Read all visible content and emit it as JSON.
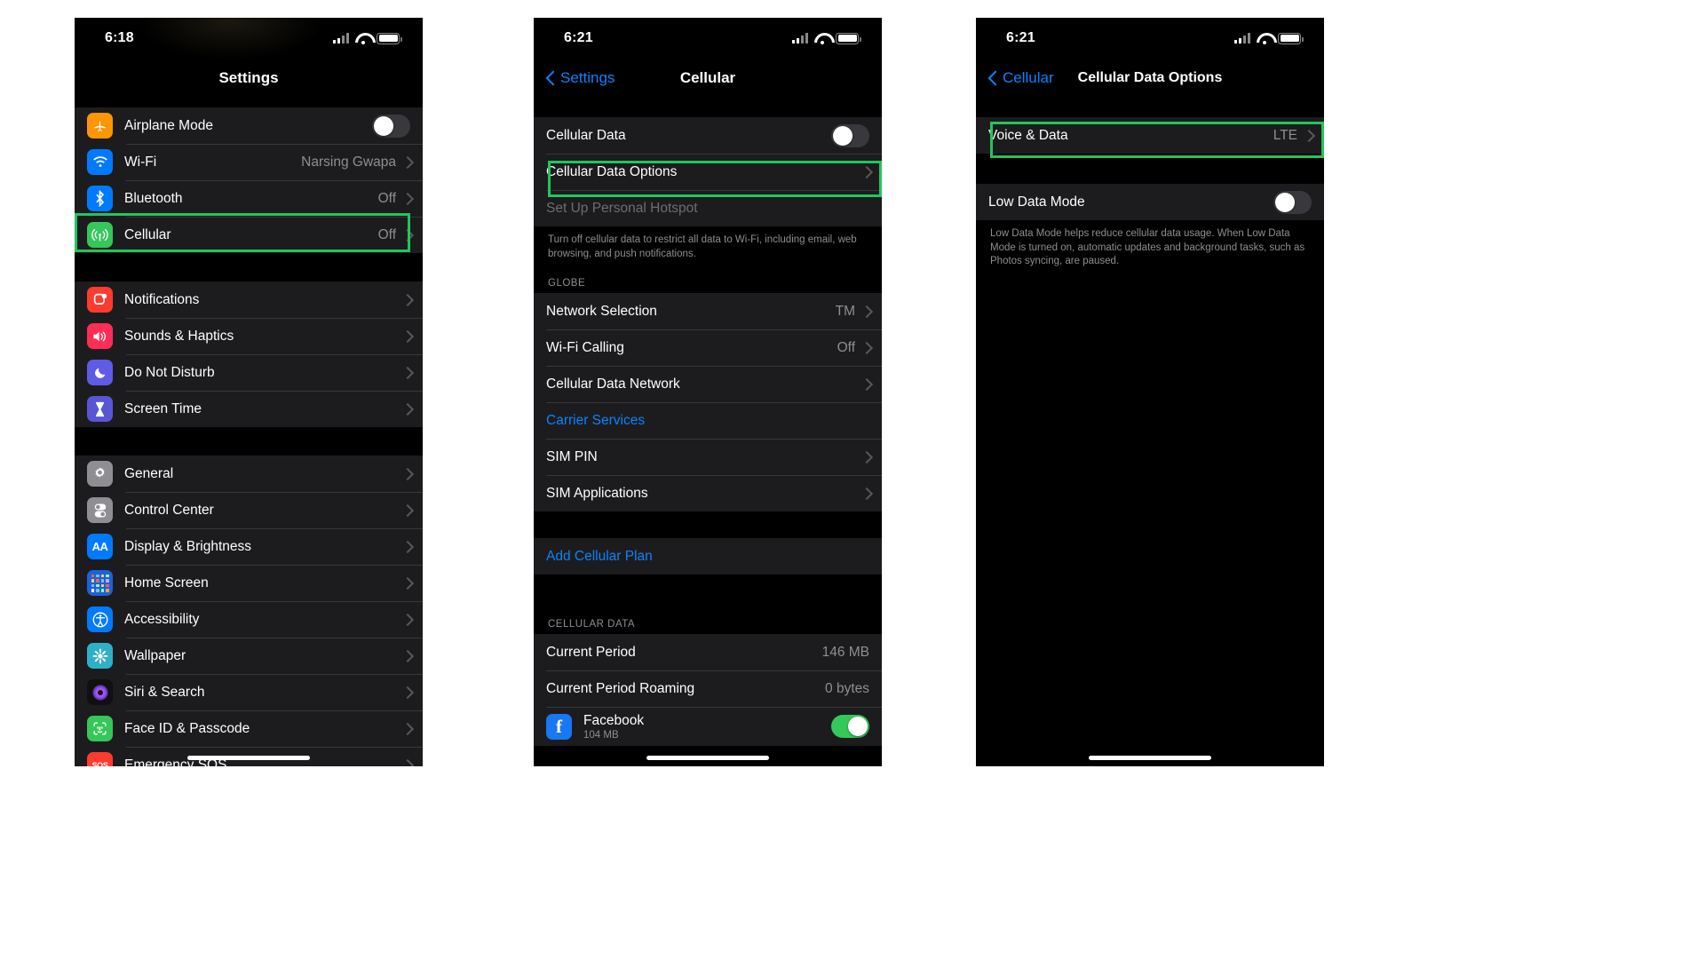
{
  "screens": [
    {
      "id": "settings-root",
      "status": {
        "time": "6:18",
        "signal_icon": "cellular-bars-icon",
        "wifi_icon": "wifi-icon",
        "battery_icon": "battery-icon"
      },
      "nav": {
        "title": "Settings",
        "back_label": null
      },
      "sections": [
        {
          "rows": [
            {
              "icon": "airplane-icon",
              "icon_class": "ic-airplane",
              "glyph": "✈",
              "label": "Airplane Mode",
              "control": "switch",
              "switch_on": false
            },
            {
              "icon": "wifi-icon",
              "icon_class": "ic-wifi",
              "glyph": "wifi",
              "label": "Wi-Fi",
              "value": "Narsing Gwapa",
              "control": "chevron"
            },
            {
              "icon": "bluetooth-icon",
              "icon_class": "ic-bluetooth",
              "glyph": "ᛗ",
              "label": "Bluetooth",
              "value": "Off",
              "control": "chevron"
            },
            {
              "icon": "cellular-icon",
              "icon_class": "ic-cellular",
              "glyph": "cellular",
              "label": "Cellular",
              "value": "Off",
              "control": "chevron",
              "highlight": true
            }
          ]
        },
        {
          "rows": [
            {
              "icon": "notifications-icon",
              "icon_class": "ic-notifications",
              "glyph": "notif",
              "label": "Notifications",
              "control": "chevron"
            },
            {
              "icon": "sounds-icon",
              "icon_class": "ic-sounds",
              "glyph": "🔊",
              "label": "Sounds & Haptics",
              "control": "chevron"
            },
            {
              "icon": "do-not-disturb-icon",
              "icon_class": "ic-dnd",
              "glyph": "☽",
              "label": "Do Not Disturb",
              "control": "chevron"
            },
            {
              "icon": "screen-time-icon",
              "icon_class": "ic-screentime",
              "glyph": "⌛",
              "label": "Screen Time",
              "control": "chevron"
            }
          ]
        },
        {
          "rows": [
            {
              "icon": "general-gear-icon",
              "icon_class": "ic-general",
              "glyph": "⚙",
              "label": "General",
              "control": "chevron"
            },
            {
              "icon": "control-center-icon",
              "icon_class": "ic-controlcenter",
              "glyph": "toggles",
              "label": "Control Center",
              "control": "chevron"
            },
            {
              "icon": "display-brightness-icon",
              "icon_class": "ic-display",
              "glyph": "AA",
              "label": "Display & Brightness",
              "control": "chevron"
            },
            {
              "icon": "home-screen-icon",
              "icon_class": "ic-homescreen",
              "glyph": "grid",
              "label": "Home Screen",
              "control": "chevron"
            },
            {
              "icon": "accessibility-icon",
              "icon_class": "ic-accessibility",
              "glyph": "accessibility",
              "label": "Accessibility",
              "control": "chevron"
            },
            {
              "icon": "wallpaper-icon",
              "icon_class": "ic-wallpaper",
              "glyph": "✿",
              "label": "Wallpaper",
              "control": "chevron"
            },
            {
              "icon": "siri-search-icon",
              "icon_class": "ic-siri",
              "glyph": "siri",
              "label": "Siri & Search",
              "control": "chevron"
            },
            {
              "icon": "face-id-icon",
              "icon_class": "ic-faceid",
              "glyph": "face",
              "label": "Face ID & Passcode",
              "control": "chevron"
            },
            {
              "icon": "emergency-sos-icon",
              "icon_class": "ic-emergency",
              "glyph": "SOS",
              "label": "Emergency SOS",
              "control": "chevron"
            }
          ]
        }
      ]
    },
    {
      "id": "cellular",
      "status": {
        "time": "6:21"
      },
      "nav": {
        "title": "Cellular",
        "back_label": "Settings"
      },
      "sections": [
        {
          "rows": [
            {
              "label": "Cellular Data",
              "control": "switch",
              "switch_on": false
            },
            {
              "label": "Cellular Data Options",
              "control": "chevron",
              "highlight": true
            },
            {
              "label": "Set Up Personal Hotspot",
              "control": "none",
              "dim": true
            }
          ],
          "footnote": "Turn off cellular data to restrict all data to Wi-Fi, including email, web browsing, and push notifications."
        },
        {
          "header": "GLOBE",
          "rows": [
            {
              "label": "Network Selection",
              "value": "TM",
              "control": "chevron"
            },
            {
              "label": "Wi-Fi Calling",
              "value": "Off",
              "control": "chevron"
            },
            {
              "label": "Cellular Data Network",
              "control": "chevron"
            },
            {
              "label": "Carrier Services",
              "control": "none",
              "blue": true
            },
            {
              "label": "SIM PIN",
              "control": "chevron"
            },
            {
              "label": "SIM Applications",
              "control": "chevron"
            }
          ]
        },
        {
          "rows": [
            {
              "label": "Add Cellular Plan",
              "control": "none",
              "blue": true
            }
          ]
        },
        {
          "header": "CELLULAR DATA",
          "rows": [
            {
              "label": "Current Period",
              "value": "146 MB",
              "control": "none"
            },
            {
              "label": "Current Period Roaming",
              "value": "0 bytes",
              "control": "none"
            },
            {
              "icon": "facebook-icon",
              "icon_class": "ic-facebook",
              "glyph": "f",
              "label": "Facebook",
              "sublabel": "104 MB",
              "control": "switch",
              "switch_on": true
            }
          ]
        }
      ]
    },
    {
      "id": "cellular-data-options",
      "status": {
        "time": "6:21"
      },
      "nav": {
        "title": "Cellular Data Options",
        "back_label": "Cellular"
      },
      "sections": [
        {
          "rows": [
            {
              "label": "Voice & Data",
              "value": "LTE",
              "control": "chevron",
              "highlight": true
            }
          ]
        },
        {
          "rows": [
            {
              "label": "Low Data Mode",
              "control": "switch",
              "switch_on": false
            }
          ],
          "footnote": "Low Data Mode helps reduce cellular data usage. When Low Data Mode is turned on, automatic updates and background tasks, such as Photos syncing, are paused."
        }
      ]
    }
  ],
  "colors": {
    "highlight": "#22c55e",
    "accent_blue": "#0a84ff",
    "switch_on": "#34c759",
    "group_bg": "#1c1c1e",
    "page_bg": "#000000",
    "secondary_text": "#8e8e93"
  }
}
